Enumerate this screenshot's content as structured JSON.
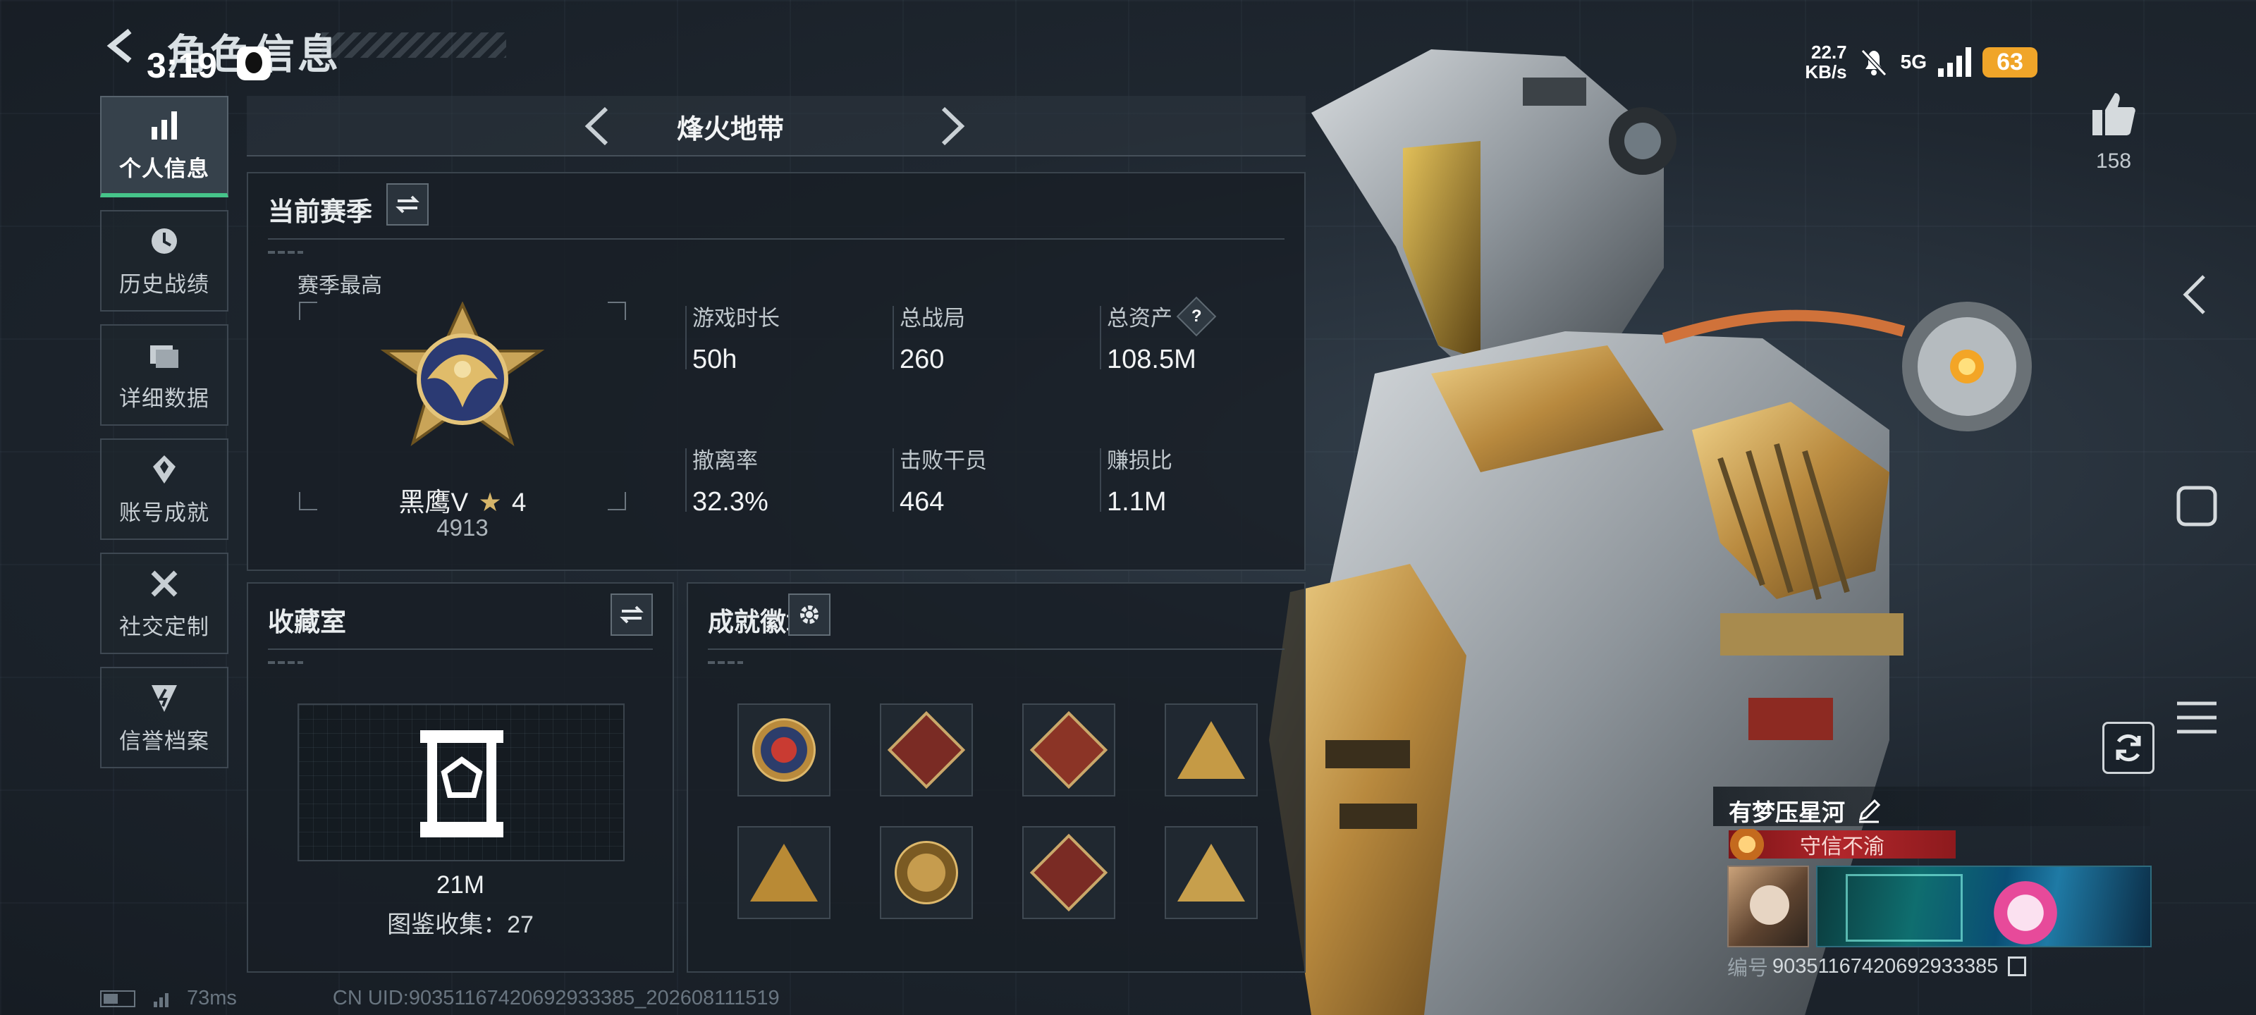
{
  "status_bar": {
    "time": "3:19",
    "net_speed_value": "22.7",
    "net_speed_unit": "KB/s",
    "network": "5G",
    "battery": "63"
  },
  "header": {
    "title": "角色信息"
  },
  "nav": {
    "items": [
      {
        "label": "个人信息",
        "icon": "bar-chart-icon",
        "active": true
      },
      {
        "label": "历史战绩",
        "icon": "history-clock-icon",
        "active": false
      },
      {
        "label": "详细数据",
        "icon": "folder-icon",
        "active": false
      },
      {
        "label": "账号成就",
        "icon": "achievement-medal-icon",
        "active": false
      },
      {
        "label": "社交定制",
        "icon": "tools-icon",
        "active": false
      },
      {
        "label": "信誉档案",
        "icon": "shield-credit-icon",
        "active": false
      }
    ]
  },
  "mode_selector": {
    "title": "烽火地带"
  },
  "season": {
    "title": "当前赛季",
    "best_label": "赛季最高",
    "rank_name": "黑鹰V",
    "rank_stars": "4",
    "rank_score": "4913",
    "stats": [
      {
        "label": "游戏时长",
        "value": "50h"
      },
      {
        "label": "总战局",
        "value": "260"
      },
      {
        "label": "总资产",
        "value": "108.5M",
        "help": "?"
      },
      {
        "label": "撤离率",
        "value": "32.3%"
      },
      {
        "label": "击败干员",
        "value": "464"
      },
      {
        "label": "赚损比",
        "value": "1.1M"
      }
    ]
  },
  "collection": {
    "title": "收藏室",
    "value": "21M",
    "count_label": "图鉴收集：27"
  },
  "badges": {
    "title": "成就徽章",
    "items": [
      {
        "icon": "star-roundel-badge-icon"
      },
      {
        "icon": "dragon-diamond-badge-icon"
      },
      {
        "icon": "runner-diamond-badge-icon"
      },
      {
        "icon": "mountain-triangle-badge-icon"
      },
      {
        "icon": "tower-triangle-badge-icon"
      },
      {
        "icon": "crest-2025-badge-icon"
      },
      {
        "icon": "dragon-diamond-badge-icon"
      },
      {
        "icon": "camp-triangle-badge-icon"
      }
    ]
  },
  "footer": {
    "ping": "73ms",
    "uid_line": "CN UID:90351167420692933385_202608111519"
  },
  "profile": {
    "likes": "158",
    "player_name": "有梦压星河",
    "title_tag": "守信不渝",
    "id_label": "编号",
    "id_value": "90351167420692933385"
  },
  "colors": {
    "accent_green": "#46c48a",
    "battery_orange": "#f0a529",
    "title_tag_red": "#b0262b"
  }
}
